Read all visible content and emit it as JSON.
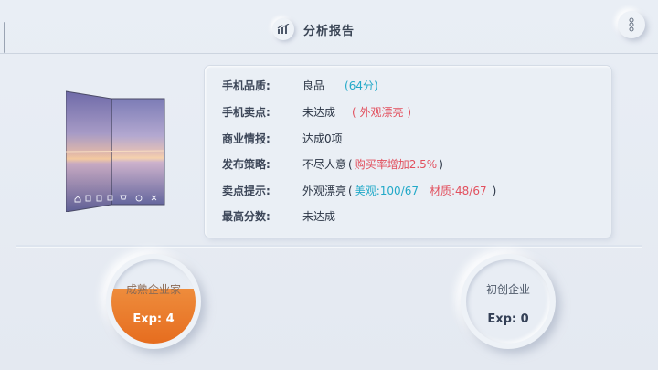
{
  "header": {
    "title": "分析报告"
  },
  "report": {
    "quality": {
      "label": "手机品质:",
      "value": "良品",
      "score": "(64分)"
    },
    "selling_point": {
      "label": "手机卖点:",
      "value": "未达成",
      "note": "( 外观漂亮 )"
    },
    "intel": {
      "label": "商业情报:",
      "value": "达成0项"
    },
    "strategy": {
      "label": "发布策略:",
      "value": "不尽人意",
      "open": "(",
      "note": "购买率增加2.5%",
      "close": ")"
    },
    "hint": {
      "label": "卖点提示:",
      "value": "外观漂亮",
      "open": "(",
      "a_label": "美观:",
      "a_val": "100/67",
      "b_label": "材质:",
      "b_val": "48/67",
      "close": ")"
    },
    "best": {
      "label": "最高分数:",
      "value": "未达成"
    }
  },
  "levels": [
    {
      "name": "成熟企业家",
      "exp": "Exp: 4",
      "progress": 0.65
    },
    {
      "name": "初创企业",
      "exp": "Exp: 0",
      "progress": 0
    }
  ],
  "colors": {
    "accent_teal": "#22a9c8",
    "accent_red": "#e2505e",
    "progress_orange": "#e8761f"
  },
  "icons": [
    "chart-icon",
    "menu-icon",
    "home-icon",
    "grid-icon",
    "list-icon",
    "cart-icon",
    "globe-icon",
    "tool-icon"
  ]
}
